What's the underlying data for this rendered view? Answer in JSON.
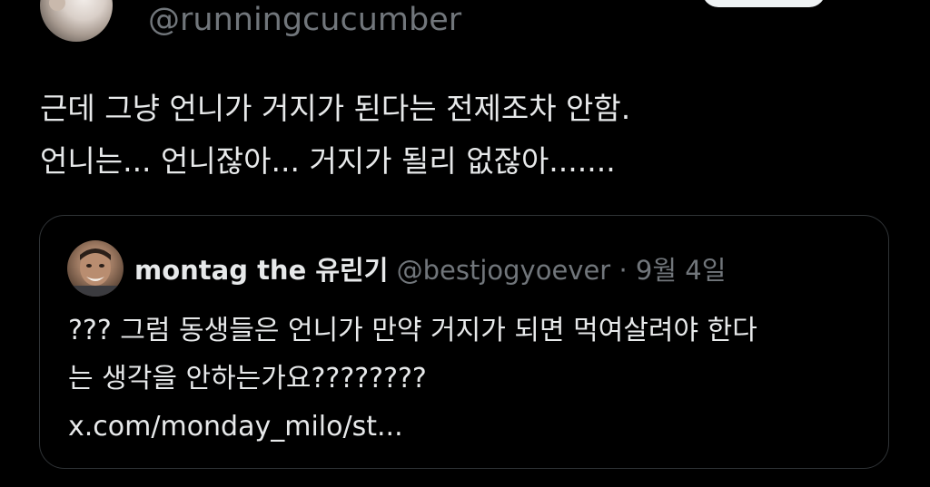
{
  "author": {
    "handle": "@runningcucumber"
  },
  "tweet": {
    "lines": [
      "근데 그냥 언니가 거지가 된다는 전제조차 안함.",
      "언니는... 언니잖아... 거지가 될리 없잖아......."
    ]
  },
  "quoted_tweet": {
    "name": "montag the 유린기",
    "handle": "@bestjogyoever",
    "separator": "·",
    "date": "9월 4일",
    "lines": [
      "??? 그럼 동생들은 언니가 만약 거지가 되면 먹여살려야 한다",
      "는 생각을 안하는가요????????",
      "x.com/monday_milo/st..."
    ]
  },
  "colors": {
    "background": "#000000",
    "text_primary": "#e7e9ea",
    "text_secondary": "#71767b",
    "border": "#2f3336"
  }
}
